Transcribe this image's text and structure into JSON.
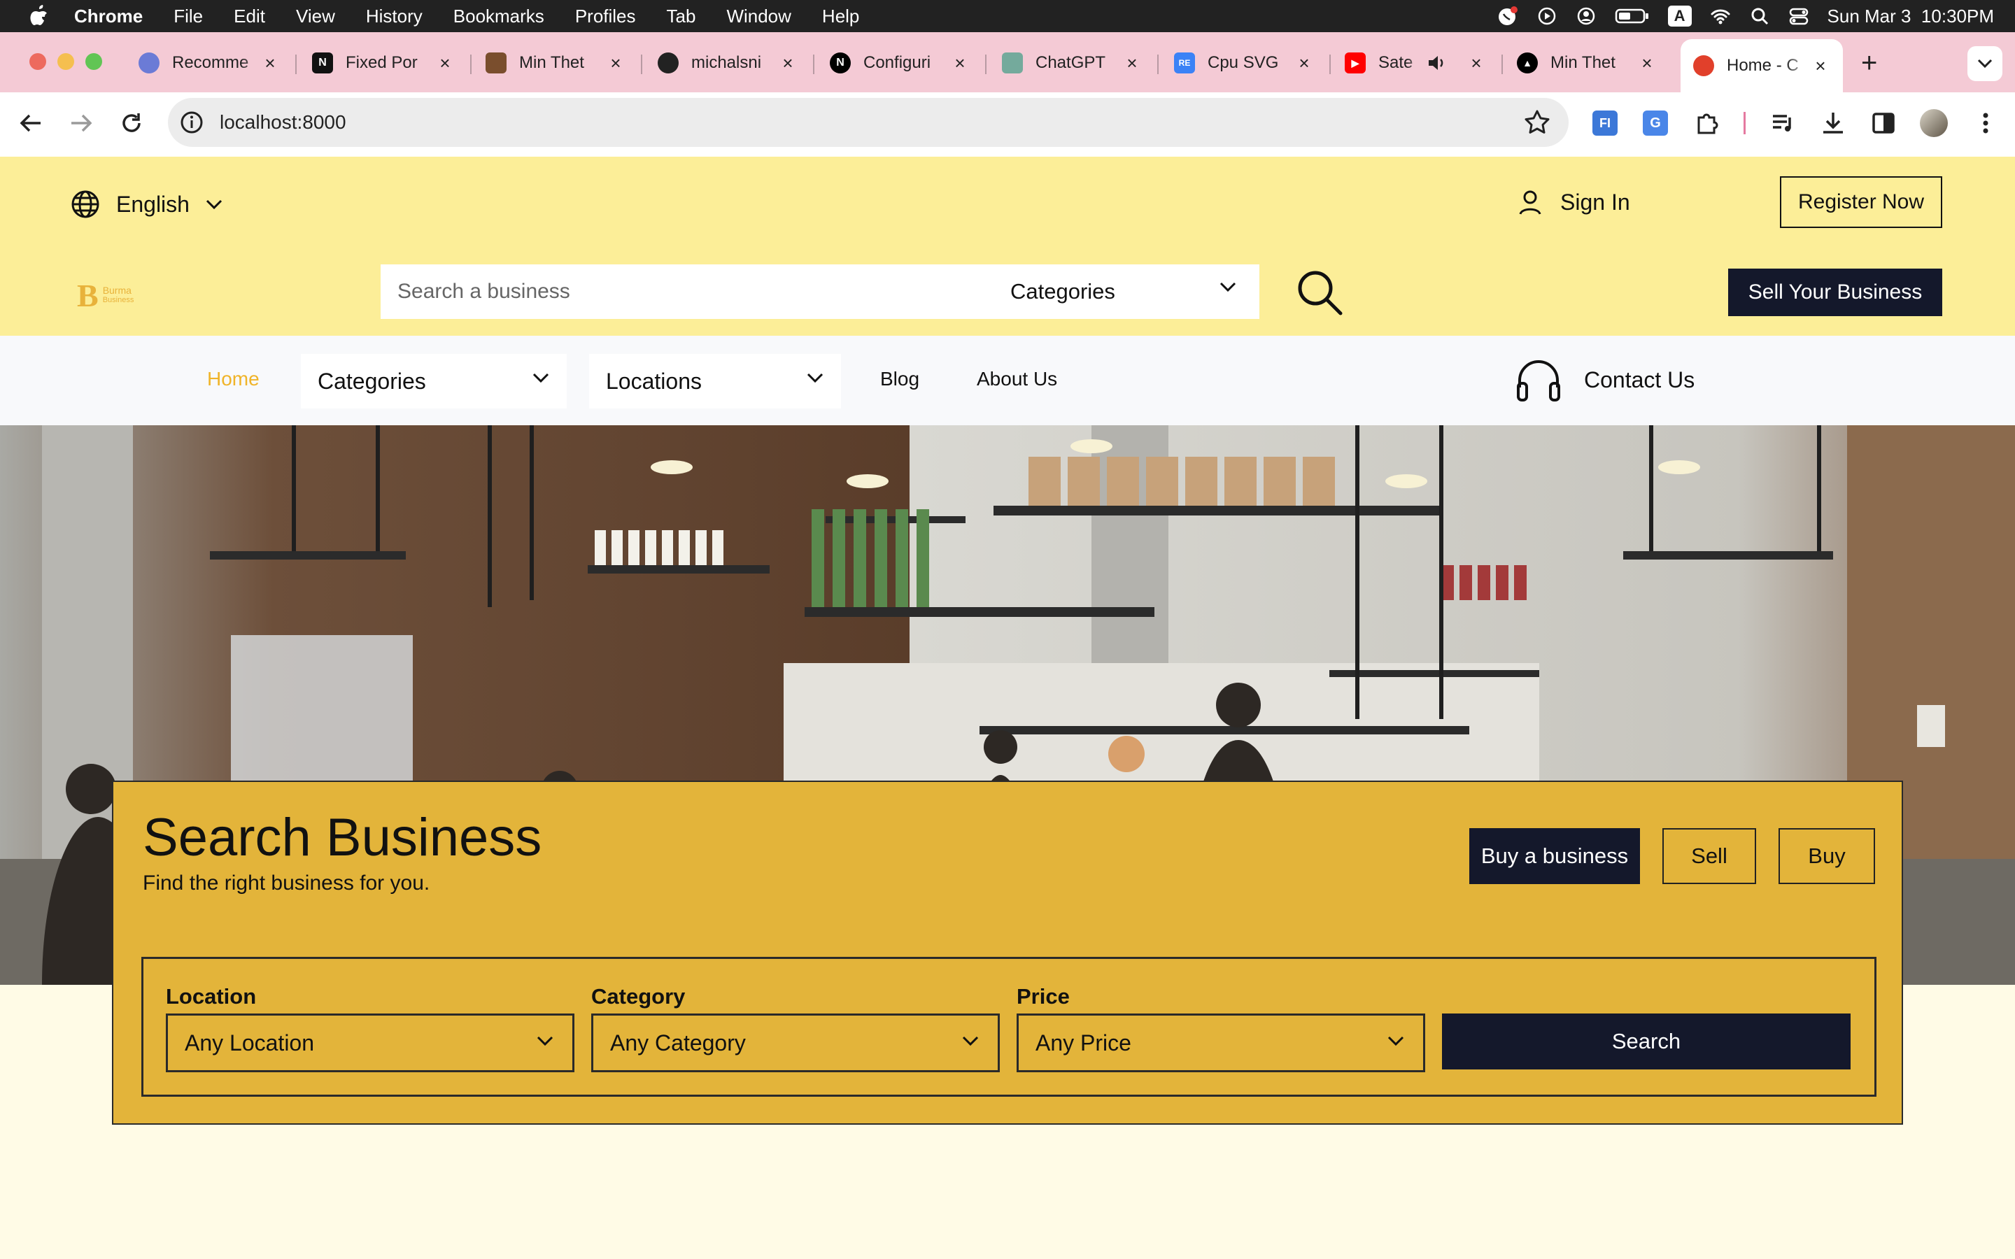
{
  "menubar": {
    "app": "Chrome",
    "items": [
      "File",
      "Edit",
      "View",
      "History",
      "Bookmarks",
      "Profiles",
      "Tab",
      "Window",
      "Help"
    ],
    "clock": "Sun Mar 3  10:30PM",
    "input_source": "A"
  },
  "tabs": [
    {
      "title": "Recomme",
      "icon": "openai-style-icon",
      "color": "#6b7bd6"
    },
    {
      "title": "Fixed Por",
      "icon": "notion-icon",
      "color": "#111111"
    },
    {
      "title": "Min Thet",
      "icon": "house-icon",
      "color": "#7a4e2d"
    },
    {
      "title": "michalsni",
      "icon": "github-icon",
      "color": "#222222"
    },
    {
      "title": "Configuri",
      "icon": "nextjs-icon",
      "color": "#000000"
    },
    {
      "title": "ChatGPT",
      "icon": "chatgpt-icon",
      "color": "#74aa9c"
    },
    {
      "title": "Cpu SVG",
      "icon": "repo-icon",
      "color": "#3b82f6"
    },
    {
      "title": "Sate",
      "icon": "youtube-icon",
      "color": "#ff0000"
    },
    {
      "title": "Min Thet",
      "icon": "vercel-icon",
      "color": "#000000"
    },
    {
      "title": "Home - C",
      "icon": "site-icon",
      "color": "#e1402b",
      "active": true
    }
  ],
  "address": {
    "url": "localhost:8000"
  },
  "header": {
    "language": "English",
    "sign_in": "Sign In",
    "register": "Register Now",
    "logo_text_1": "Burma",
    "logo_text_2": "Business",
    "search_placeholder": "Search a business",
    "categories_label": "Categories",
    "sell_button": "Sell Your Business"
  },
  "nav": {
    "home": "Home",
    "categories": "Categories",
    "locations": "Locations",
    "blog": "Blog",
    "about": "About Us",
    "contact": "Contact Us"
  },
  "panel": {
    "title": "Search Business",
    "subtitle": "Find the right business for you.",
    "buttons": {
      "buy_business": "Buy a business",
      "sell": "Sell",
      "buy": "Buy"
    },
    "filters": {
      "location": {
        "label": "Location",
        "value": "Any Location"
      },
      "category": {
        "label": "Category",
        "value": "Any Category"
      },
      "price": {
        "label": "Price",
        "value": "Any Price"
      }
    },
    "search_button": "Search"
  },
  "colors": {
    "header_bg": "#fcee98",
    "panel_bg": "#e3b43a",
    "dark": "#14182b",
    "home_link": "#f0b429",
    "page_bg": "#fffbe6"
  }
}
